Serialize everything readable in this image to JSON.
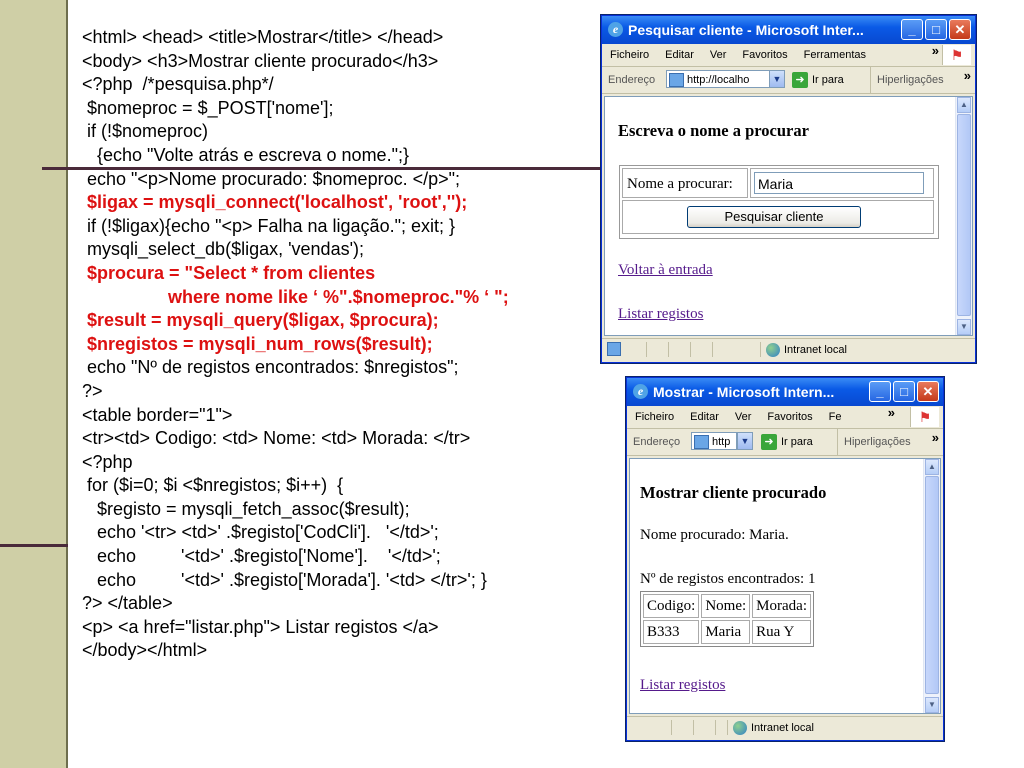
{
  "code_lines": [
    {
      "text": "<html> <head> <title>Mostrar</title> </head>",
      "style": "normal"
    },
    {
      "text": "<body> <h3>Mostrar cliente procurado</h3>",
      "style": "normal"
    },
    {
      "text": "<?php  /*pesquisa.php*/",
      "style": "normal"
    },
    {
      "text": " $nomeproc = $_POST['nome'];",
      "style": "normal"
    },
    {
      "text": " if (!$nomeproc)",
      "style": "normal"
    },
    {
      "text": "   {echo \"Volte atrás e escreva o nome.\";}",
      "style": "normal"
    },
    {
      "text": " echo \"<p>Nome procurado: $nomeproc. </p>\";",
      "style": "normal"
    },
    {
      "text": " $ligax = mysqli_connect('localhost', 'root','');",
      "style": "red"
    },
    {
      "text": " if (!$ligax){echo \"<p> Falha na ligação.\"; exit; }",
      "style": "normal"
    },
    {
      "text": " mysqli_select_db($ligax, 'vendas');",
      "style": "normal"
    },
    {
      "text": " $procura = \"Select * from clientes",
      "style": "red"
    },
    {
      "text": "where nome like ‘ %\".$nomeproc.\"% ‘ \";",
      "style": "cont"
    },
    {
      "text": " $result = mysqli_query($ligax, $procura);",
      "style": "red"
    },
    {
      "text": " $nregistos = mysqli_num_rows($result);",
      "style": "red"
    },
    {
      "text": " echo \"Nº de registos encontrados: $nregistos\";",
      "style": "normal"
    },
    {
      "text": "?>",
      "style": "normal"
    },
    {
      "text": "<table border=\"1\">",
      "style": "normal"
    },
    {
      "text": "<tr><td> Codigo: <td> Nome: <td> Morada: </tr>",
      "style": "normal"
    },
    {
      "text": "<?php",
      "style": "normal"
    },
    {
      "text": " for ($i=0; $i <$nregistos; $i++)  {",
      "style": "normal"
    },
    {
      "text": "   $registo = mysqli_fetch_assoc($result);",
      "style": "normal"
    },
    {
      "text": "   echo '<tr> <td>' .$registo['CodCli'].   '</td>';",
      "style": "normal"
    },
    {
      "text": "   echo         '<td>' .$registo['Nome'].    '</td>';",
      "style": "normal"
    },
    {
      "text": "   echo         '<td>' .$registo['Morada']. '<td> </tr>'; }",
      "style": "normal"
    },
    {
      "text": "?> </table>",
      "style": "normal"
    },
    {
      "text": "<p> <a href=\"listar.php\"> Listar registos </a>",
      "style": "normal"
    },
    {
      "text": "</body></html>",
      "style": "normal"
    }
  ],
  "win1": {
    "title": "Pesquisar cliente - Microsoft Inter...",
    "menu": [
      "Ficheiro",
      "Editar",
      "Ver",
      "Favoritos",
      "Ferramentas"
    ],
    "address_label": "Endereço",
    "address_value": "http://localho",
    "go_label": "Ir para",
    "links_label": "Hiperligações",
    "heading": "Escreva o nome a procurar",
    "field_label": "Nome a procurar:",
    "field_value": "Maria",
    "button_label": "Pesquisar cliente",
    "link_back": "Voltar à entrada",
    "link_list": "Listar registos",
    "status_zone": "Intranet local"
  },
  "win2": {
    "title": "Mostrar - Microsoft Intern...",
    "menu": [
      "Ficheiro",
      "Editar",
      "Ver",
      "Favoritos",
      "Fe"
    ],
    "address_label": "Endereço",
    "address_value": "http",
    "go_label": "Ir para",
    "links_label": "Hiperligações",
    "heading": "Mostrar cliente procurado",
    "name_line": "Nome procurado: Maria.",
    "count_line": "Nº de registos encontrados: 1",
    "table": {
      "headers": [
        "Codigo:",
        "Nome:",
        "Morada:"
      ],
      "rows": [
        [
          "B333",
          "Maria",
          "Rua Y"
        ]
      ]
    },
    "link_list": "Listar registos",
    "status_zone": "Intranet local"
  }
}
